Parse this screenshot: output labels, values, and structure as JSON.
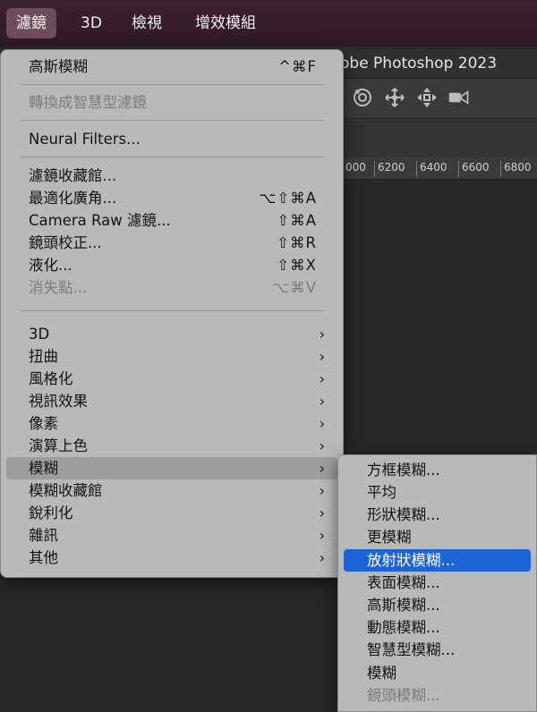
{
  "menubar": {
    "items": [
      {
        "label": "濾鏡"
      },
      {
        "label": "3D"
      },
      {
        "label": "檢視"
      },
      {
        "label": "增效模組"
      }
    ]
  },
  "app": {
    "title_partial": "obe Photoshop 2023",
    "ruler_ticks": [
      "000",
      "6200",
      "6400",
      "6600",
      "6800"
    ],
    "tool_icons": [
      "rotate-view-icon",
      "pan-icon",
      "move-3d-icon",
      "video-camera-icon"
    ]
  },
  "filter_menu": {
    "items": [
      {
        "label": "高斯模糊",
        "shortcut": "^⌘F"
      },
      {
        "label": "轉換成智慧型濾鏡",
        "disabled": true
      },
      {
        "label": "Neural Filters..."
      },
      {
        "label": "濾鏡收藏館..."
      },
      {
        "label": "最適化廣角...",
        "shortcut": "⌥⇧⌘A"
      },
      {
        "label": "Camera Raw 濾鏡...",
        "shortcut": "⇧⌘A"
      },
      {
        "label": "鏡頭校正...",
        "shortcut": "⇧⌘R"
      },
      {
        "label": "液化...",
        "shortcut": "⇧⌘X"
      },
      {
        "label": "消失點...",
        "shortcut": "⌥⌘V",
        "disabled": true
      },
      {
        "label": "3D",
        "submenu": true
      },
      {
        "label": "扭曲",
        "submenu": true
      },
      {
        "label": "風格化",
        "submenu": true
      },
      {
        "label": "視訊效果",
        "submenu": true
      },
      {
        "label": "像素",
        "submenu": true
      },
      {
        "label": "演算上色",
        "submenu": true
      },
      {
        "label": "模糊",
        "submenu": true,
        "highlighted": true
      },
      {
        "label": "模糊收藏館",
        "submenu": true
      },
      {
        "label": "銳利化",
        "submenu": true
      },
      {
        "label": "雜訊",
        "submenu": true
      },
      {
        "label": "其他",
        "submenu": true
      }
    ],
    "submenu_arrow": "›"
  },
  "blur_submenu": {
    "items": [
      {
        "label": "方框模糊..."
      },
      {
        "label": "平均"
      },
      {
        "label": "形狀模糊..."
      },
      {
        "label": "更模糊"
      },
      {
        "label": "放射狀模糊...",
        "selected": true
      },
      {
        "label": "表面模糊..."
      },
      {
        "label": "高斯模糊..."
      },
      {
        "label": "動態模糊..."
      },
      {
        "label": "智慧型模糊..."
      },
      {
        "label": "模糊"
      },
      {
        "label": "鏡頭模糊...",
        "disabled": true
      }
    ]
  },
  "colors": {
    "menubar_bg": "#2f1a27",
    "menu_bg": "#b9b9b9",
    "selection": "#1d64d6"
  }
}
